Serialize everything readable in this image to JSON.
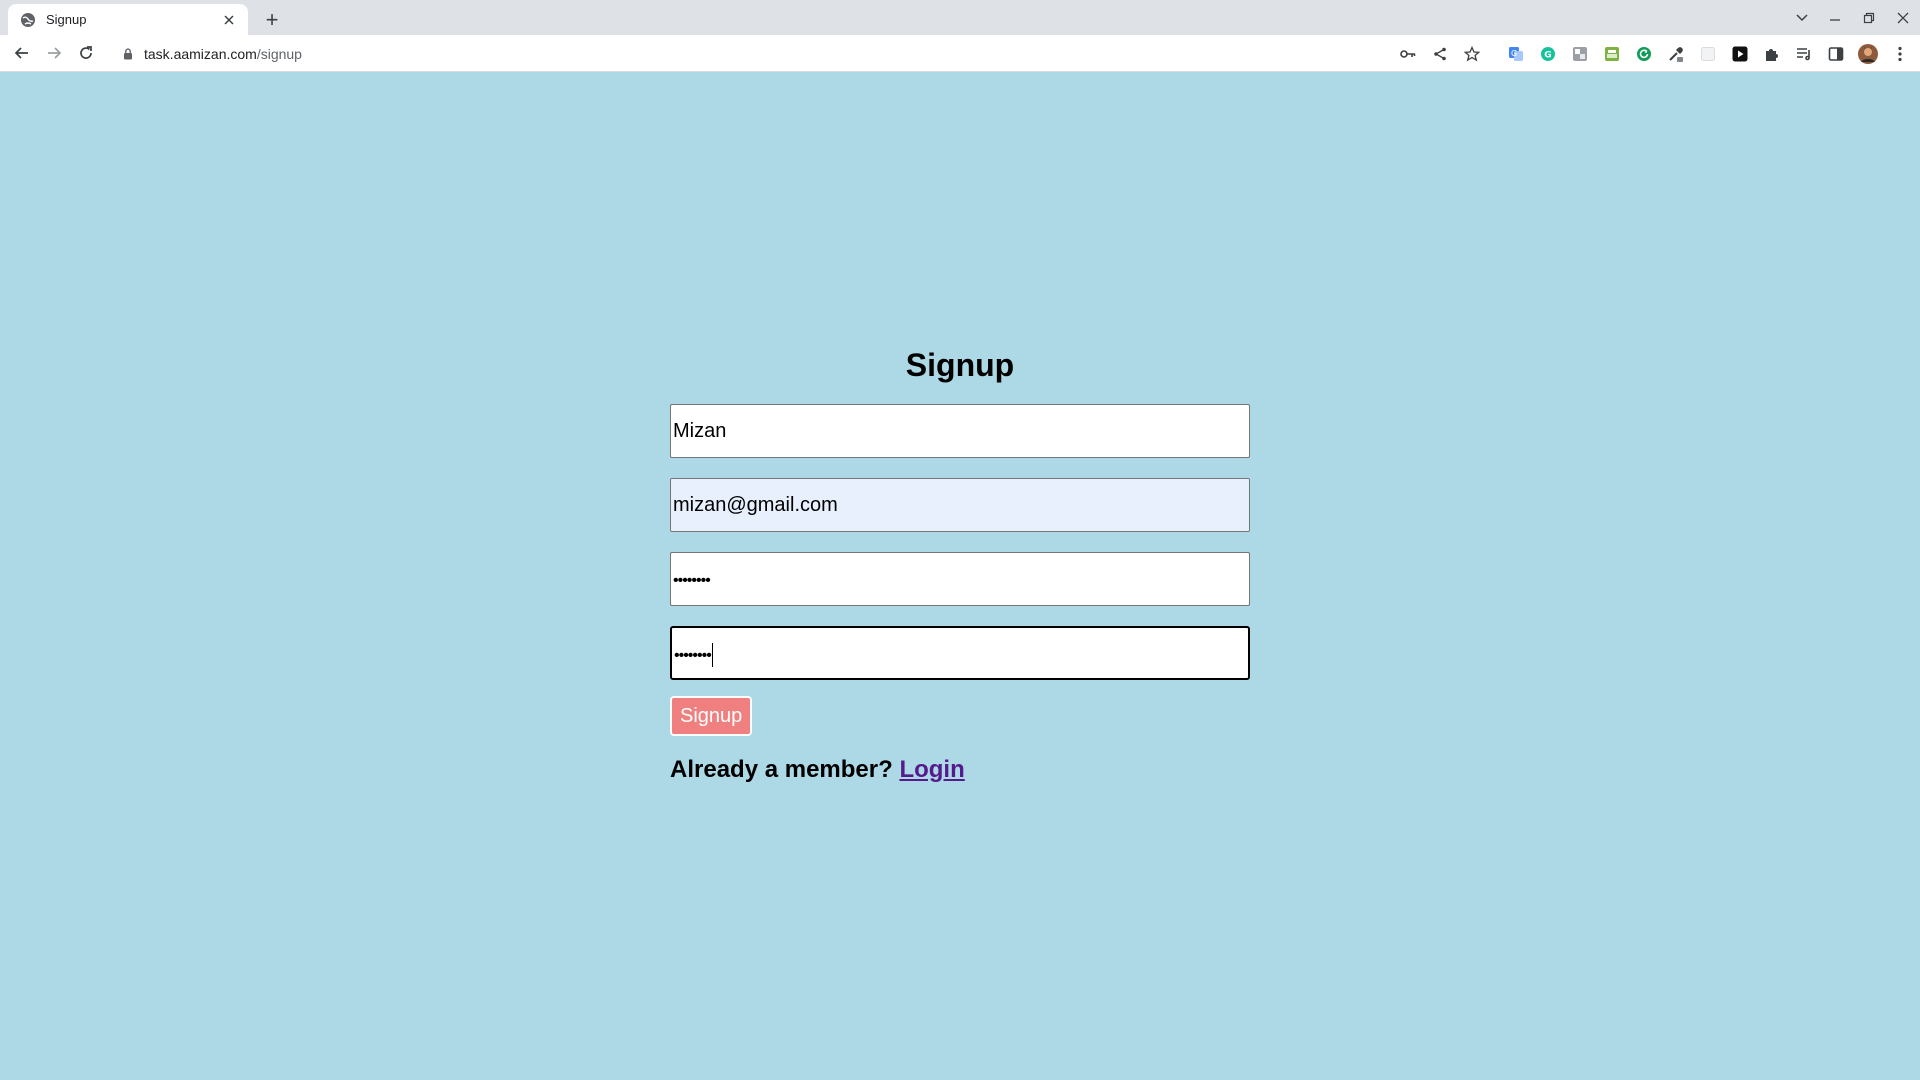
{
  "browser": {
    "tab_title": "Signup",
    "new_tab_symbol": "+",
    "url_host": "task.aamizan.com",
    "url_path": "/signup"
  },
  "page": {
    "background": "#add8e6",
    "heading": "Signup",
    "fields": {
      "name_value": "Mizan",
      "email_value": "mizan@gmail.com",
      "password_value": "••••••••",
      "confirm_password_value": "••••••••"
    },
    "submit_label": "Signup",
    "submit_color": "#f08080",
    "footer_text": "Already a member?",
    "login_link": "Login",
    "link_color": "#551a8b"
  }
}
